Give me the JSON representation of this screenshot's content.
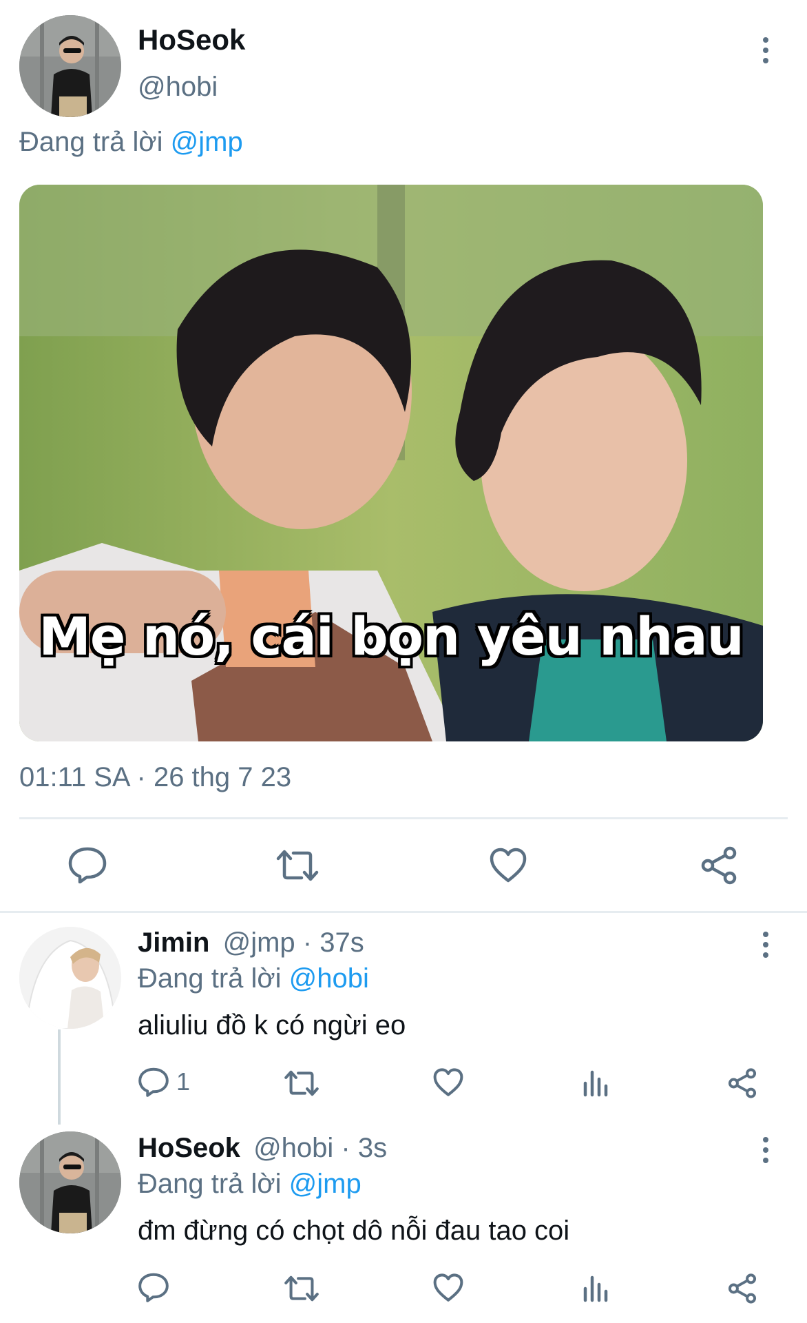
{
  "main_tweet": {
    "author_name": "HoSeok",
    "author_handle": "@hobi",
    "reply_prefix": "Đang trả lời",
    "reply_to": "@jmp",
    "image_caption": "Mẹ nó, cái bọn yêu nhau",
    "timestamp": "01:11 SA · 26 thg 7 23",
    "actions": [
      "reply-icon",
      "retweet-icon",
      "like-icon",
      "share-icon"
    ]
  },
  "replies": [
    {
      "author_name": "Jimin",
      "author_handle": "@jmp",
      "time": "· 37s",
      "reply_prefix": "Đang trả lời",
      "reply_to": "@hobi",
      "text": "aliuliu đồ k có ngừi eo",
      "reply_count": "1"
    },
    {
      "author_name": "HoSeok",
      "author_handle": "@hobi",
      "time": "· 3s",
      "reply_prefix": "Đang trả lời",
      "reply_to": "@jmp",
      "text": "đm đừng có chọt dô nỗi đau tao coi",
      "reply_count": ""
    }
  ],
  "colors": {
    "accent": "#1d9bf0",
    "secondary_text": "#5b7083",
    "divider": "#e6ecf0"
  }
}
